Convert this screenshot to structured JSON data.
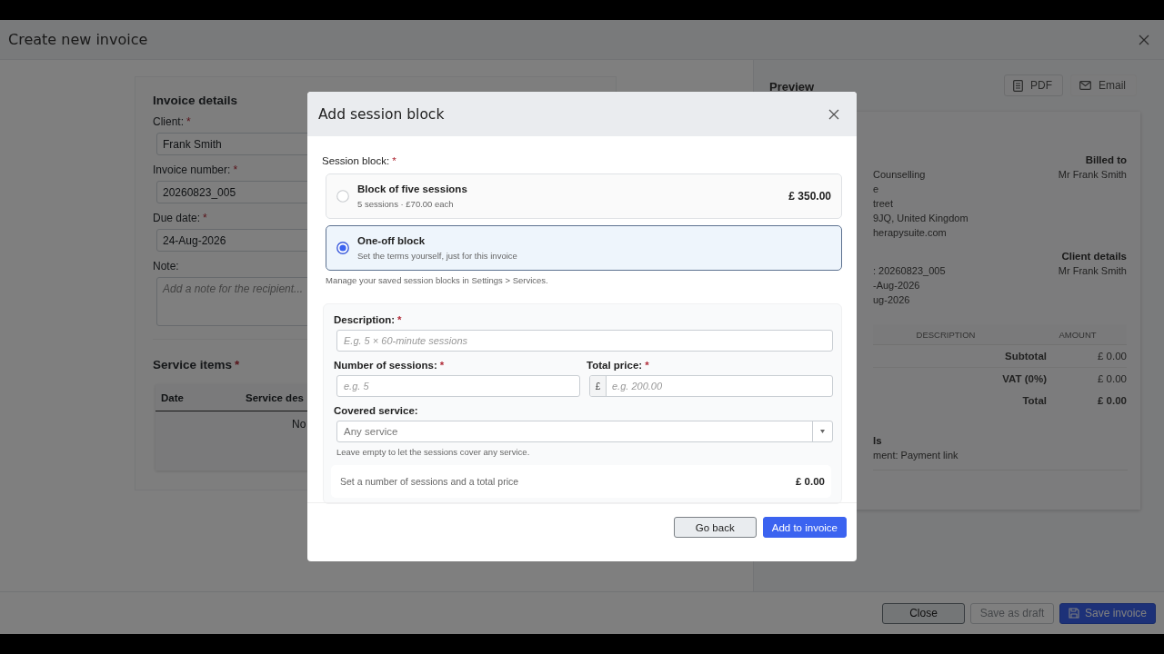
{
  "window": {
    "title": "Create new invoice"
  },
  "invoice_details": {
    "heading": "Invoice details",
    "fields": [
      {
        "label": "Client:",
        "mark": "*",
        "kind": "input",
        "value": "Frank Smith"
      },
      {
        "label": "Invoice number:",
        "mark": "*",
        "kind": "input",
        "value": "20260823_005"
      },
      {
        "label": "Due date:",
        "mark": "*",
        "kind": "input",
        "value": "24-Aug-2026"
      },
      {
        "label": "Note:",
        "kind": "textarea",
        "placeholder": "Add a note for the recipient..."
      }
    ]
  },
  "service_items": {
    "heading": "Service items",
    "mark": "*",
    "columns": [
      "Date",
      "Service des"
    ],
    "empty_text": "No"
  },
  "preview": {
    "title": "Preview",
    "buttons": [
      {
        "label": "PDF",
        "kind": "pdf"
      },
      {
        "label": "Email",
        "kind": "email"
      }
    ],
    "sender_lines": [
      "Counselling",
      "e",
      "treet",
      "9JQ, United Kingdom",
      "herapysuite.com"
    ],
    "billed_to": {
      "heading": "Billed to",
      "lines": [
        "Mr Frank Smith"
      ]
    },
    "invoice_lines": [
      ": 20260823_005",
      "-Aug-2026",
      "ug-2026"
    ],
    "client_details": {
      "heading": "Client details",
      "lines": [
        "Mr Frank Smith"
      ]
    },
    "table": {
      "columns": [
        "DESCRIPTION",
        "AMOUNT"
      ]
    },
    "totals": [
      {
        "label": "Subtotal",
        "value": "£ 0.00",
        "kind": "line"
      },
      {
        "label": "VAT (0%)",
        "value": "£ 0.00",
        "kind": "line"
      },
      {
        "label": "Total",
        "value": "£ 0.00",
        "kind": "grand"
      }
    ],
    "payment": {
      "heading": "ls",
      "lines": [
        "ment: Payment link"
      ]
    }
  },
  "footer_buttons": [
    {
      "label": "Close",
      "kind": "secondary"
    },
    {
      "label": "Save as draft",
      "kind": "disabled"
    },
    {
      "label": "Save invoice",
      "kind": "primary"
    }
  ],
  "dialog": {
    "title": "Add session block",
    "block_label": "Session block:",
    "block_mark": "*",
    "options": [
      {
        "title": "Block of five sessions",
        "subtitle": "5 sessions · £70.00 each",
        "price": "£ 350.00",
        "selected": false
      },
      {
        "title": "One-off block",
        "subtitle": "Set the terms yourself, just for this invoice",
        "selected": true
      }
    ],
    "hint": "Manage your saved session blocks in Settings > Services.",
    "description": {
      "label": "Description:",
      "mark": "*",
      "placeholder": "E.g. 5 × 60-minute sessions"
    },
    "sessions": {
      "label": "Number of sessions:",
      "mark": "*",
      "placeholder": "e.g. 5"
    },
    "price": {
      "label": "Total price:",
      "mark": "*",
      "prefix": "£",
      "placeholder": "e.g. 200.00"
    },
    "service": {
      "label": "Covered service:",
      "placeholder": "Any service",
      "help": "Leave empty to let the sessions cover any service."
    },
    "summary": {
      "text": "Set a number of sessions and a total price",
      "amount": "£ 0.00"
    },
    "buttons": [
      {
        "label": "Go back",
        "kind": "secondary"
      },
      {
        "label": "Add to invoice",
        "kind": "primary"
      }
    ]
  }
}
